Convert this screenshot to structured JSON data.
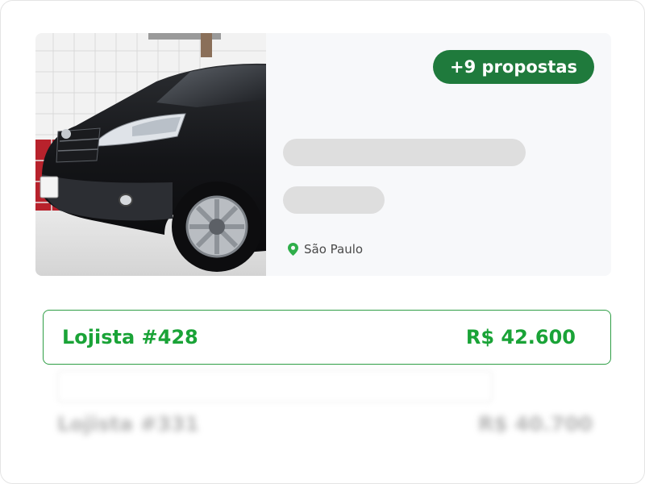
{
  "listing": {
    "offers_badge": "+9 propostas",
    "location": "São Paulo",
    "photo_icon": "car-photo"
  },
  "proposals": [
    {
      "seller": "Lojista #428",
      "price": "R$ 42.600",
      "highlighted": true
    },
    {
      "seller": "Lojista #331",
      "price": "R$ 40.700",
      "highlighted": false
    }
  ],
  "colors": {
    "badge_bg": "#1f7a3c",
    "accent_green": "#1aa337",
    "pin_green": "#2fae4a",
    "skeleton": "#dedede",
    "card_bg": "#f7f8fa"
  }
}
